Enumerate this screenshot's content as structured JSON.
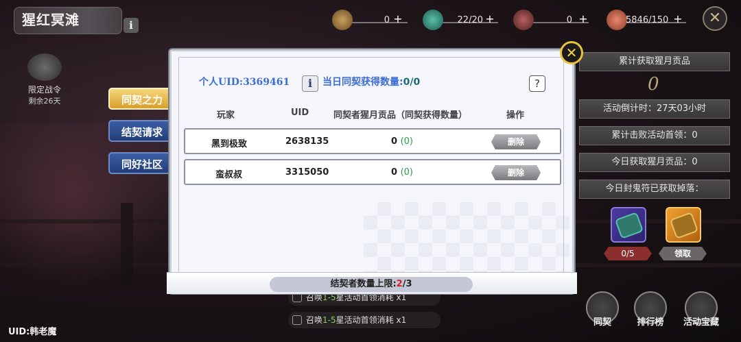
{
  "header": {
    "title": "猩红冥滩",
    "info_label": "i",
    "resources": [
      {
        "icon": "mask-token-icon",
        "value": "0",
        "plus": "+"
      },
      {
        "icon": "green-charm-icon",
        "value": "22/20",
        "plus": "+"
      },
      {
        "icon": "flower-crest-icon",
        "value": "0",
        "plus": "+"
      },
      {
        "icon": "drumstick-icon",
        "value": "5846/150",
        "plus": "+"
      }
    ],
    "close_label": "✕"
  },
  "left": {
    "battlepass_title": "限定战令",
    "battlepass_remaining": "剩余26天",
    "tabs": [
      "同契之力",
      "结契请求",
      "同好社区"
    ],
    "active_tab": 0,
    "uid_text": "UID:韩老魔"
  },
  "modal": {
    "uid_label": "个人UID:3369461",
    "info_label": "i",
    "daily_label": "当日同契获得数量:",
    "daily_value": "0/0",
    "help_label": "?",
    "columns": [
      "玩家",
      "UID",
      "同契者猩月贡品（同契获得数量）",
      "操作"
    ],
    "rows": [
      {
        "player": "黑到极致",
        "uid": "2638135",
        "tribute": "0",
        "gained": "(0)",
        "action": "删除"
      },
      {
        "player": "蛮叔叔",
        "uid": "3315050",
        "tribute": "0",
        "gained": "(0)",
        "action": "删除"
      }
    ],
    "limit_prefix": "结契者数量上限:",
    "limit_current": "2",
    "limit_suffix": "/3",
    "close_label": "✕"
  },
  "right": {
    "cumulative_title": "累计获取猩月贡品",
    "cumulative_value": "0",
    "countdown": "活动倒计时：27天03小时",
    "boss_defeated": "累计击败活动首领：0",
    "today_tribute": "今日获取猩月贡品：0",
    "today_drop": "今日封鬼符已获取掉落：",
    "reward_progress": "0/5",
    "reward_claim": "领取"
  },
  "bottom": {
    "summon_1_prefix": "召唤",
    "summon_1_highlight": "1-5",
    "summon_1_suffix": "星活动首领消耗",
    "summon_1_cost": "x1",
    "summon_2_prefix": "召唤",
    "summon_2_highlight": "1-5",
    "summon_2_suffix": "星活动首领消耗",
    "summon_2_cost": "x1",
    "buttons": [
      "同契",
      "排行榜",
      "活动宝藏"
    ]
  }
}
